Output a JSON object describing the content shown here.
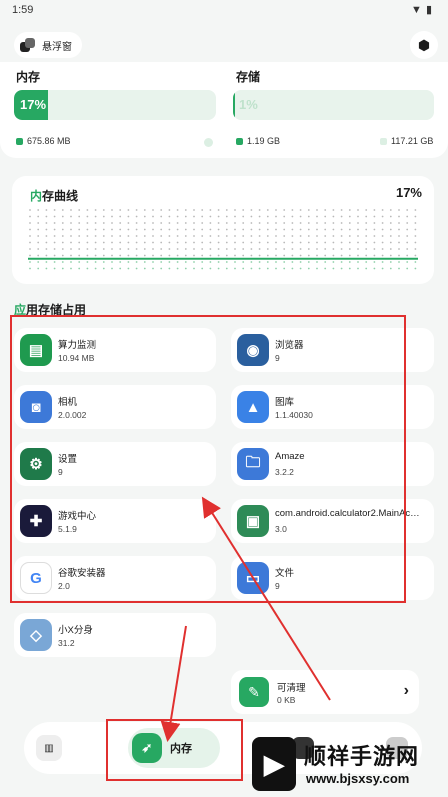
{
  "status_bar": {
    "time": "1:59",
    "icons": [
      "wifi-icon",
      "battery-icon"
    ]
  },
  "header": {
    "float_window_label": "悬浮窗"
  },
  "memory": {
    "label": "内存",
    "percent_text": "17%",
    "percent": 17,
    "used": "675.86 MB"
  },
  "storage": {
    "label": "存储",
    "percent_text": "1%",
    "percent": 1,
    "used": "1.19 GB",
    "total": "117.21 GB"
  },
  "curve": {
    "title_accent": "内",
    "title_rest": "存曲线",
    "percent_text": "17%"
  },
  "apps_section": {
    "title_accent": "应",
    "title_rest": "用存储占用"
  },
  "apps": [
    {
      "name": "算力监测",
      "size": "10.94 MB",
      "icon": "monitor-icon",
      "color": "#1f9a4f",
      "glyph": "▤"
    },
    {
      "name": "浏览器",
      "size": "9",
      "icon": "globe-icon",
      "color": "#2a5f9e",
      "glyph": "◉"
    },
    {
      "name": "相机",
      "size": "2.0.002",
      "icon": "camera-icon",
      "color": "#3d79d8",
      "glyph": "◙"
    },
    {
      "name": "图库",
      "size": "1.1.40030",
      "icon": "gallery-icon",
      "color": "#3a82e6",
      "glyph": "▲"
    },
    {
      "name": "设置",
      "size": "9",
      "icon": "settings-gear-icon",
      "color": "#1f7a4a",
      "glyph": "⚙"
    },
    {
      "name": "Amaze",
      "size": "3.2.2",
      "icon": "folder-search-icon",
      "color": "#3d79d8",
      "glyph": "🗀"
    },
    {
      "name": "游戏中心",
      "size": "5.1.9",
      "icon": "gamepad-icon",
      "color": "#1a1a3a",
      "glyph": "✚"
    },
    {
      "name": "com.android.calculator2.MainAc…",
      "size": "3.0",
      "icon": "android-icon",
      "color": "#2e8b57",
      "glyph": "▣"
    },
    {
      "name": "谷歌安装器",
      "size": "2.0",
      "icon": "google-icon",
      "color": "#ffffff",
      "glyph": "G"
    },
    {
      "name": "文件",
      "size": "9",
      "icon": "files-icon",
      "color": "#3d79d8",
      "glyph": "▭"
    },
    {
      "name": "小X分身",
      "size": "31.2",
      "icon": "clone-icon",
      "color": "#7aa7d6",
      "glyph": "◇"
    }
  ],
  "cleanable": {
    "label": "可清理",
    "size": "0 KB"
  },
  "nav": {
    "active_label": "内存"
  },
  "watermark": {
    "brand": "顺祥手游网",
    "url": "www.bjsxsy.com"
  },
  "colors": {
    "accent": "#27a862",
    "annotation": "#e0302f"
  }
}
